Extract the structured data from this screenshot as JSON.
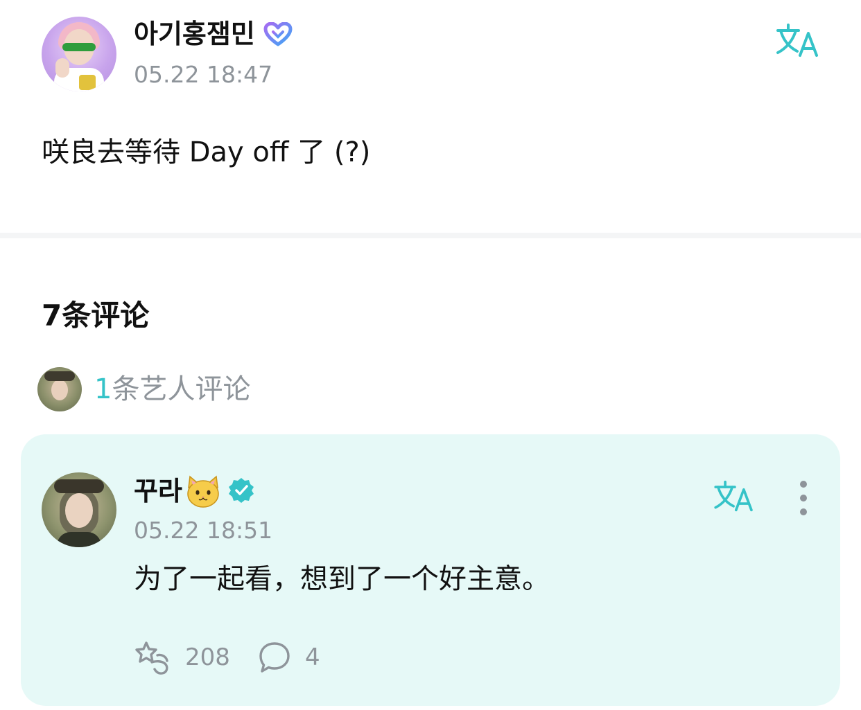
{
  "post": {
    "author": "아기홍잼민",
    "timestamp": "05.22 18:47",
    "body": "咲良去等待 Day off 了 (?)",
    "avatar_icon": "user-avatar",
    "badge_icon": "membership-heart-icon",
    "translate_icon": "translate-icon"
  },
  "comments_section": {
    "count_label": "7条评论",
    "artist_comments": {
      "count": "1",
      "label": "条艺人评论"
    }
  },
  "artist_comment": {
    "author": "꾸라",
    "emoji": "🐱",
    "timestamp": "05.22 18:51",
    "body": "为了一起看，想到了一个好主意。",
    "likes": "208",
    "replies": "4",
    "badge_icon": "verified-check-icon",
    "like_icon": "like-star-icon",
    "reply_icon": "reply-bubble-icon",
    "more_icon": "more-vertical-icon"
  },
  "colors": {
    "accent": "#35c3c8",
    "card_background": "#e6f9f7",
    "secondary_text": "#8e949a",
    "badge_purple": "#8b6cf0",
    "badge_blue": "#4aa3f5"
  }
}
